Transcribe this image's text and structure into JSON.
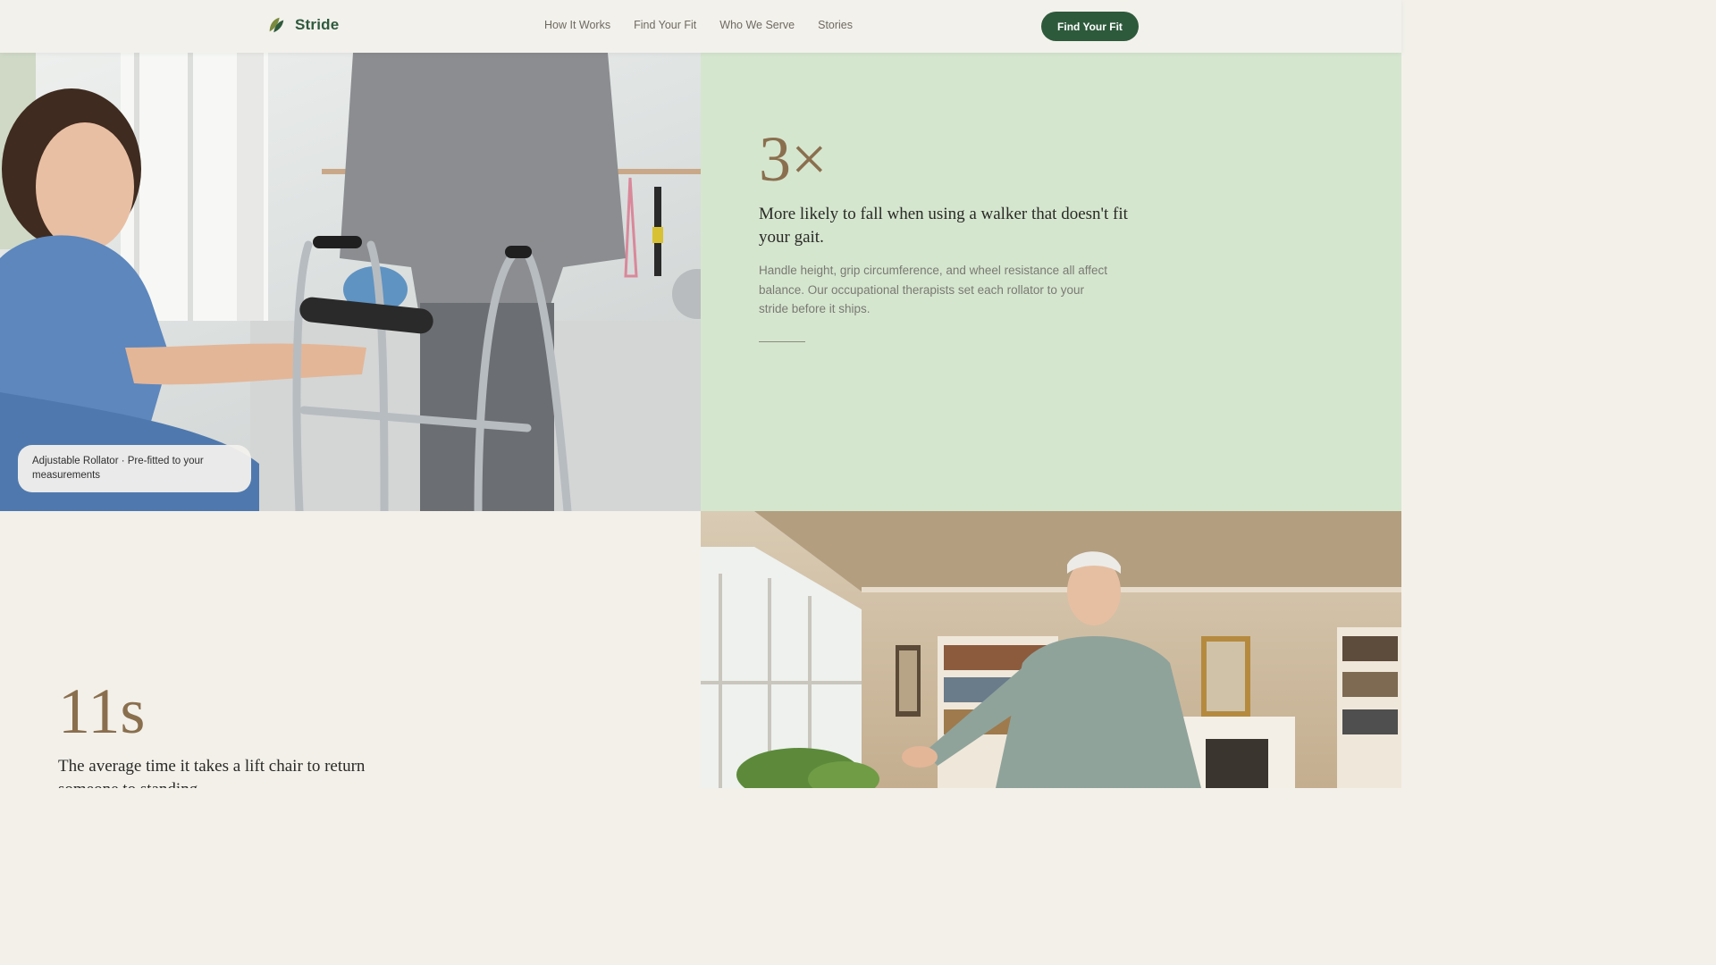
{
  "header": {
    "brand": "Stride",
    "nav": [
      "How It Works",
      "Find Your Fit",
      "Who We Serve",
      "Stories"
    ],
    "cta_label": "Find Your Fit"
  },
  "walker_image": {
    "caption": "Adjustable Rollator · Pre-fitted to your measurements"
  },
  "stat_fall": {
    "figure": "3×",
    "headline": "More likely to fall when using a walker that doesn't fit your gait.",
    "body": "Handle height, grip circumference, and wheel resistance all affect balance. Our occupational therapists set each rollator to your stride before it ships."
  },
  "stat_chair": {
    "figure": "11s",
    "headline": "The average time it takes a lift chair to return someone to standing."
  },
  "colors": {
    "brand_green": "#2e5a3c",
    "stat_gold": "#8a6f4e",
    "panel_green": "#d5e6cf",
    "cream": "#f3f0ea"
  },
  "icons": {
    "logo": "leaf-icon"
  }
}
